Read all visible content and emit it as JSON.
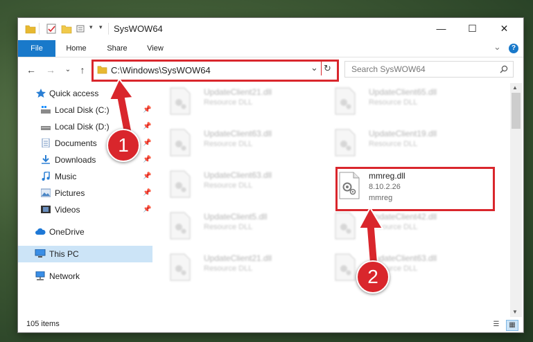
{
  "window": {
    "title": "SysWOW64",
    "minimize_glyph": "—",
    "maximize_glyph": "☐",
    "close_glyph": "✕"
  },
  "ribbon": {
    "tabs": [
      {
        "label": "File",
        "active": true
      },
      {
        "label": "Home"
      },
      {
        "label": "Share"
      },
      {
        "label": "View"
      }
    ],
    "collapse_glyph": "⌄",
    "help_glyph": "?"
  },
  "address": {
    "path": "C:\\Windows\\SysWOW64",
    "dropdown_glyph": "⌄",
    "refresh_glyph": "↻"
  },
  "nav": {
    "back_glyph": "←",
    "forward_glyph": "→",
    "recent_glyph": "⌄",
    "up_glyph": "↑"
  },
  "search": {
    "placeholder": "Search SysWOW64",
    "icon": "search-icon"
  },
  "sidebar": {
    "items": [
      {
        "label": "Quick access",
        "icon": "star-icon",
        "pinned": false
      },
      {
        "label": "Local Disk (C:)",
        "icon": "drive-icon",
        "pinned": true
      },
      {
        "label": "Local Disk (D:)",
        "icon": "drive-icon",
        "pinned": true
      },
      {
        "label": "Documents",
        "icon": "documents-icon",
        "pinned": true
      },
      {
        "label": "Downloads",
        "icon": "download-icon",
        "pinned": true
      },
      {
        "label": "Music",
        "icon": "music-icon",
        "pinned": true
      },
      {
        "label": "Pictures",
        "icon": "pictures-icon",
        "pinned": true
      },
      {
        "label": "Videos",
        "icon": "videos-icon",
        "pinned": true
      },
      {
        "label": "OneDrive",
        "icon": "cloud-icon",
        "pinned": false
      },
      {
        "label": "This PC",
        "icon": "computer-icon",
        "pinned": false,
        "selected": true
      },
      {
        "label": "Network",
        "icon": "network-icon",
        "pinned": false
      }
    ],
    "pin_glyph": "📌"
  },
  "files": [
    {
      "name": "UpdateClient21.dll",
      "sub": "Resource DLL",
      "blurred": true
    },
    {
      "name": "UpdateClient65.dll",
      "sub": "Resource DLL",
      "blurred": true
    },
    {
      "name": "UpdateClient63.dll",
      "sub": "Resource DLL",
      "blurred": true
    },
    {
      "name": "UpdateClient19.dll",
      "sub": "Resource DLL",
      "blurred": true
    },
    {
      "name": "UpdateClient63.dll",
      "sub": "Resource DLL",
      "blurred": true
    },
    {
      "name": "mmreg.dll",
      "sub": "8.10.2.26",
      "sub2": "mmreg",
      "blurred": false
    },
    {
      "name": "UpdateClient5.dll",
      "sub": "Resource DLL",
      "blurred": true
    },
    {
      "name": "UpdateClient42.dll",
      "sub": "Resource DLL",
      "blurred": true
    },
    {
      "name": "UpdateClient21.dll",
      "sub": "Resource DLL",
      "blurred": true
    },
    {
      "name": "UpdateClient63.dll",
      "sub": "Resource DLL",
      "blurred": true
    }
  ],
  "status": {
    "item_count": "105 items"
  },
  "callouts": [
    {
      "number": "1"
    },
    {
      "number": "2"
    }
  ],
  "colors": {
    "accent": "#1979ca",
    "highlight": "#d9262c",
    "selected": "#cce4f7"
  }
}
